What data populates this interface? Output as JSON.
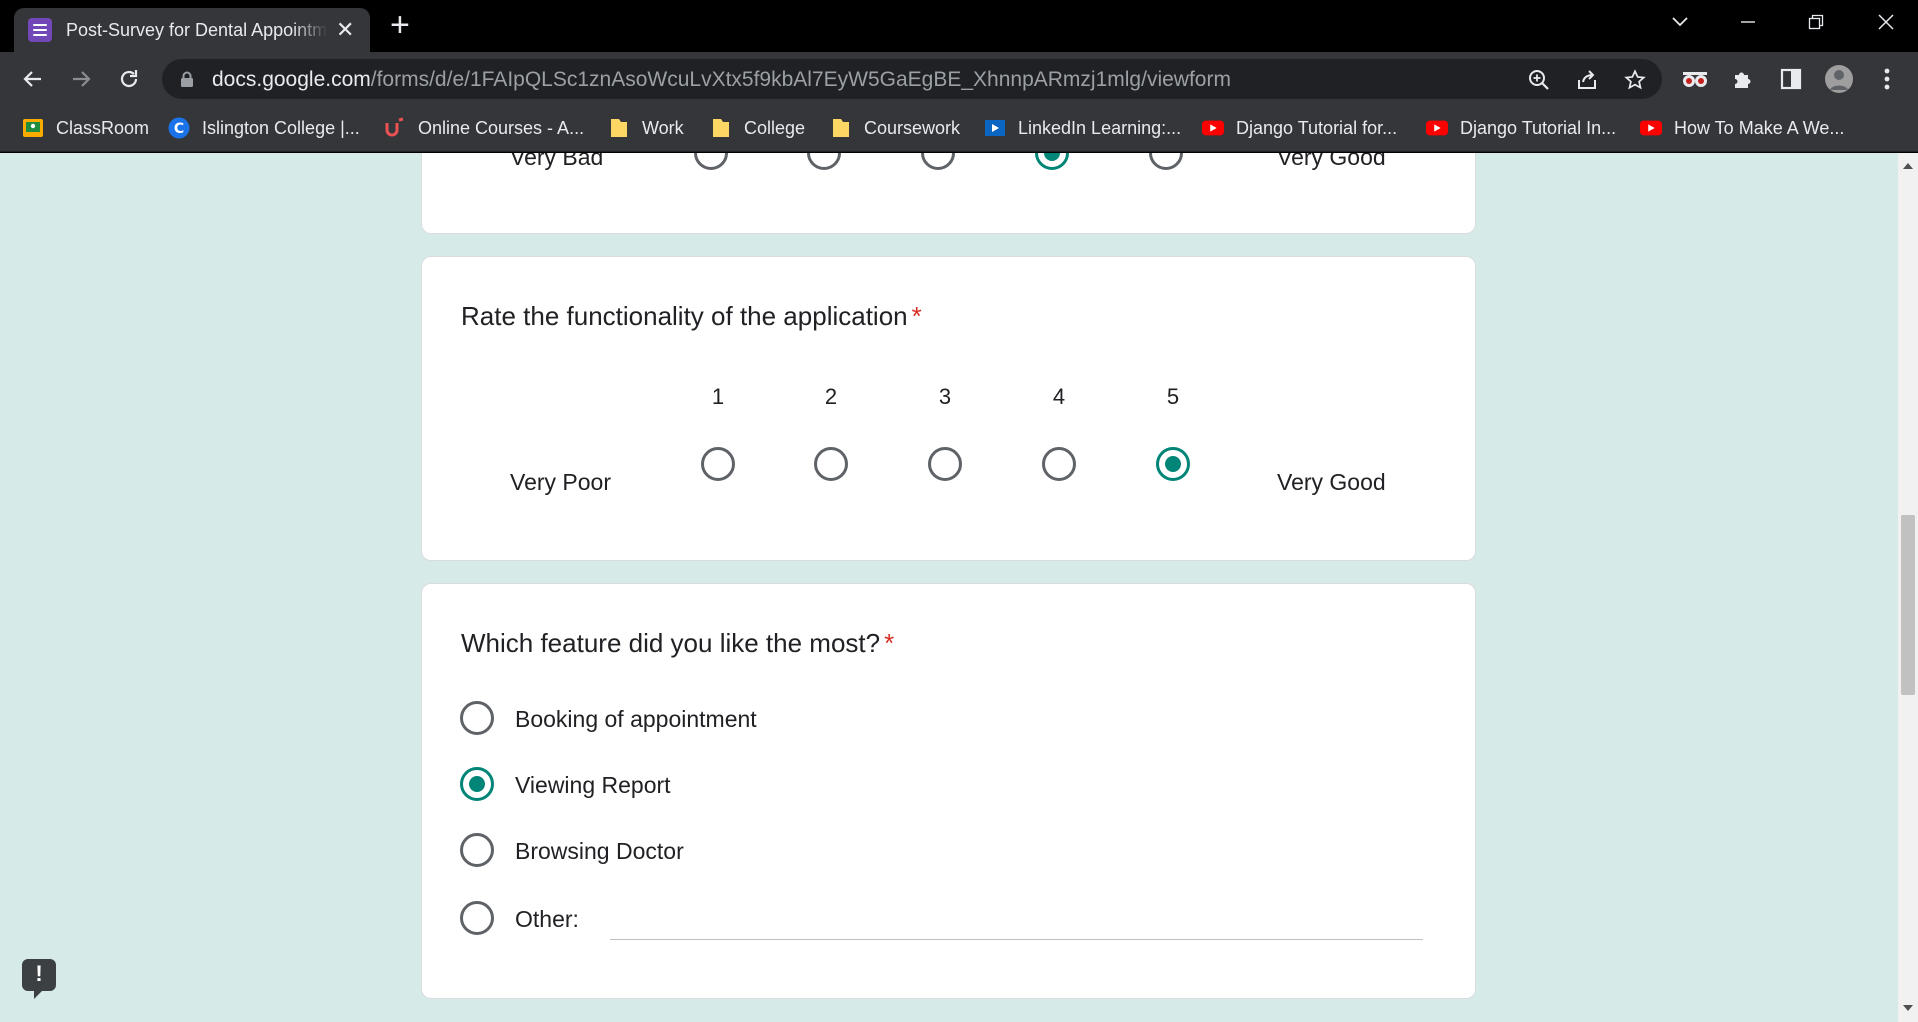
{
  "browser": {
    "tab_title": "Post-Survey for Dental Appointment",
    "url_host": "docs.google.com",
    "url_path": "/forms/d/e/1FAIpQLSc1znAsoWcuLvXtx5f9kbAl7EyW5GaEgBE_XhnnpARmzj1mlg/viewform",
    "bookmarks": [
      {
        "label": "ClassRoom",
        "icon": "classroom-icon"
      },
      {
        "label": "Islington College |...",
        "icon": "college-c-icon"
      },
      {
        "label": "Online Courses - A...",
        "icon": "udemy-icon"
      },
      {
        "label": "Work",
        "icon": "folder-icon"
      },
      {
        "label": "College",
        "icon": "folder-icon"
      },
      {
        "label": "Coursework",
        "icon": "folder-icon"
      },
      {
        "label": "LinkedIn Learning:...",
        "icon": "linkedin-learning-icon"
      },
      {
        "label": "Django Tutorial for...",
        "icon": "youtube-icon"
      },
      {
        "label": "Django Tutorial In...",
        "icon": "youtube-icon"
      },
      {
        "label": "How To Make A We...",
        "icon": "youtube-icon"
      }
    ]
  },
  "form": {
    "prev_question": {
      "low_label": "Very Bad",
      "high_label": "Very Good",
      "selected": 4
    },
    "functionality_question": {
      "title": "Rate the functionality of the application",
      "required_mark": "*",
      "scale": [
        "1",
        "2",
        "3",
        "4",
        "5"
      ],
      "low_label": "Very Poor",
      "high_label": "Very Good",
      "selected": 5
    },
    "feature_question": {
      "title": "Which feature did you like the most?",
      "required_mark": "*",
      "options": [
        "Booking of appointment",
        "Viewing Report",
        "Browsing Doctor",
        "Other:"
      ],
      "selected": "Viewing Report"
    },
    "feedback_label": "!"
  },
  "colors": {
    "accent": "#008577",
    "page_background": "#d6ebe8",
    "required": "#d93025"
  }
}
